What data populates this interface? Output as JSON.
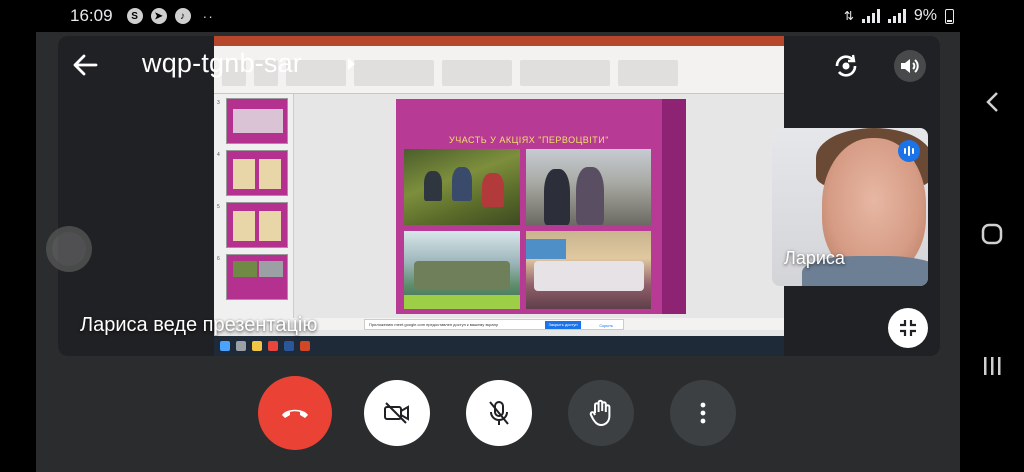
{
  "status_bar": {
    "time": "16:09",
    "left_icons": [
      "whatsapp-icon",
      "navigation-icon",
      "music-icon"
    ],
    "dots": "··",
    "battery": "9%"
  },
  "meeting": {
    "code": "wqp-tgnb-sar",
    "presenter_caption": "Лариса веде презентацію"
  },
  "self_tile": {
    "name": "Лариса"
  },
  "shared_screen": {
    "slide_title": "УЧАСТЬ У АКЦІЯХ \"ПЕРВОЦВІТИ\"",
    "share_banner": "Приложению meet.google.com предоставлен доступ к вашему экрану.",
    "stop_label": "Закрыть доступ",
    "hide_label": "Скрыть",
    "thumb_numbers": [
      "3",
      "4",
      "5",
      "6"
    ]
  },
  "controls": {
    "end_call": "call-end-icon",
    "camera": "camera-off-icon",
    "mic": "mic-off-icon",
    "hand": "raise-hand-icon",
    "more": "more-vert-icon"
  },
  "colors": {
    "end_call_red": "#ea4335",
    "control_grey": "#3c4043",
    "speaking_blue": "#1a73e8",
    "slide_magenta": "#b73a95",
    "slide_title_yellow": "#f1e06b"
  }
}
